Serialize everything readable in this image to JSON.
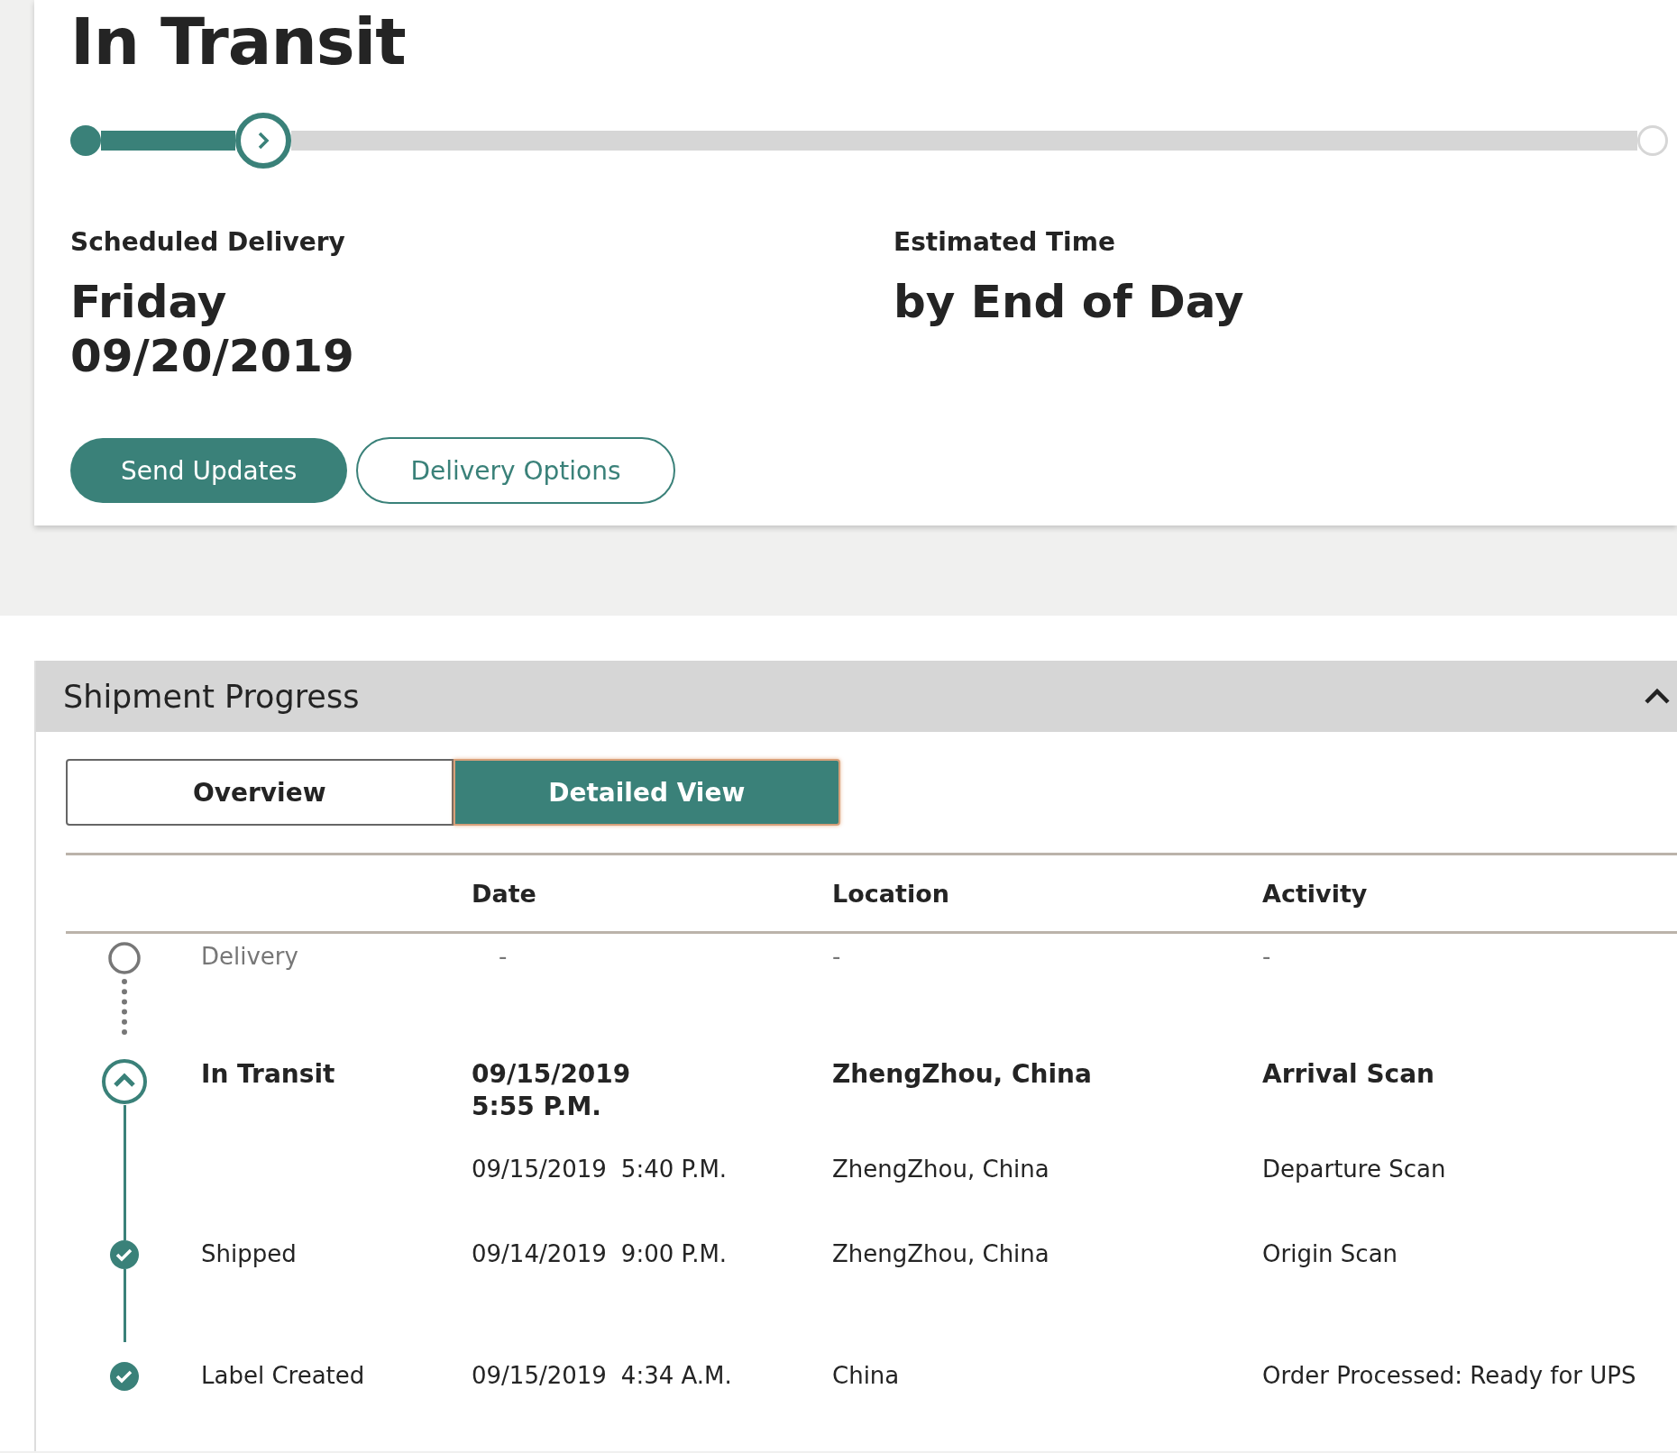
{
  "status": {
    "title": "In Transit",
    "progress": {
      "level": 0.09
    },
    "scheduled": {
      "label": "Scheduled Delivery",
      "day": "Friday",
      "date": "09/20/2019"
    },
    "estimated": {
      "label": "Estimated Time",
      "value": "by End of Day"
    },
    "buttons": [
      {
        "label": "Send Updates",
        "kind": "primary"
      },
      {
        "label": "Delivery Options",
        "kind": "outline"
      }
    ]
  },
  "shipment_progress": {
    "title": "Shipment Progress",
    "expanded": true,
    "tabs": [
      {
        "label": "Overview",
        "selected": false
      },
      {
        "label": "Detailed View",
        "selected": true
      }
    ],
    "table": {
      "columns": [
        "Date",
        "Location",
        "Activity"
      ],
      "rows": [
        {
          "kind": "pending",
          "status": "Delivery",
          "date": "-",
          "location": "-",
          "activity": "-"
        },
        {
          "kind": "current",
          "status": "In Transit",
          "date": "09/15/2019 5:55 P.M.",
          "location": "ZhengZhou, China",
          "activity": "Arrival Scan"
        },
        {
          "kind": "sub",
          "date": "09/15/2019",
          "time": "5:40 P.M.",
          "location": "ZhengZhou, China",
          "activity": "Departure Scan"
        },
        {
          "kind": "done",
          "status": "Shipped",
          "date": "09/14/2019",
          "time": "9:00 P.M.",
          "location": "ZhengZhou, China",
          "activity": "Origin Scan"
        },
        {
          "kind": "done",
          "status": "Label Created",
          "date": "09/15/2019",
          "time": "4:34 A.M.",
          "location": "China",
          "activity": "Order Processed: Ready for UPS"
        }
      ]
    }
  }
}
